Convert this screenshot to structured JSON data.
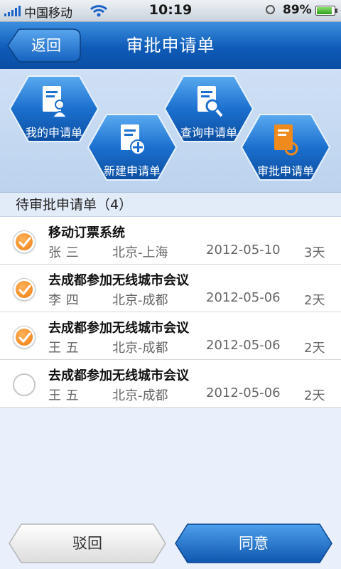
{
  "status": {
    "carrier": "中国移动",
    "time": "10:19",
    "battery": "89%",
    "battery_level": 0.89
  },
  "header": {
    "back_label": "返回",
    "title": "审批申请单"
  },
  "actions": [
    {
      "label": "我的申请单",
      "icon": "person-document-icon"
    },
    {
      "label": "新建申请单",
      "icon": "add-document-icon"
    },
    {
      "label": "查询申请单",
      "icon": "search-document-icon"
    },
    {
      "label": "审批申请单",
      "icon": "key-document-icon"
    }
  ],
  "section": {
    "title": "待审批申请单（4）"
  },
  "requests": [
    {
      "subject": "移动订票系统",
      "name": "张  三",
      "route": "北京-上海",
      "date": "2012-05-10",
      "days": "3天",
      "checked": true
    },
    {
      "subject": "去成都参加无线城市会议",
      "name": "李  四",
      "route": "北京-成都",
      "date": "2012-05-06",
      "days": "2天",
      "checked": true
    },
    {
      "subject": "去成都参加无线城市会议",
      "name": "王  五",
      "route": "北京-成都",
      "date": "2012-05-06",
      "days": "2天",
      "checked": true
    },
    {
      "subject": "去成都参加无线城市会议",
      "name": "王  五",
      "route": "北京-成都",
      "date": "2012-05-06",
      "days": "2天",
      "checked": false
    }
  ],
  "footer": {
    "reject_label": "驳回",
    "agree_label": "同意"
  },
  "colors": {
    "brand_blue": "#0f5bb8",
    "check_orange": "#ef7d12",
    "hex_orange_icon": "#f08a1c"
  }
}
